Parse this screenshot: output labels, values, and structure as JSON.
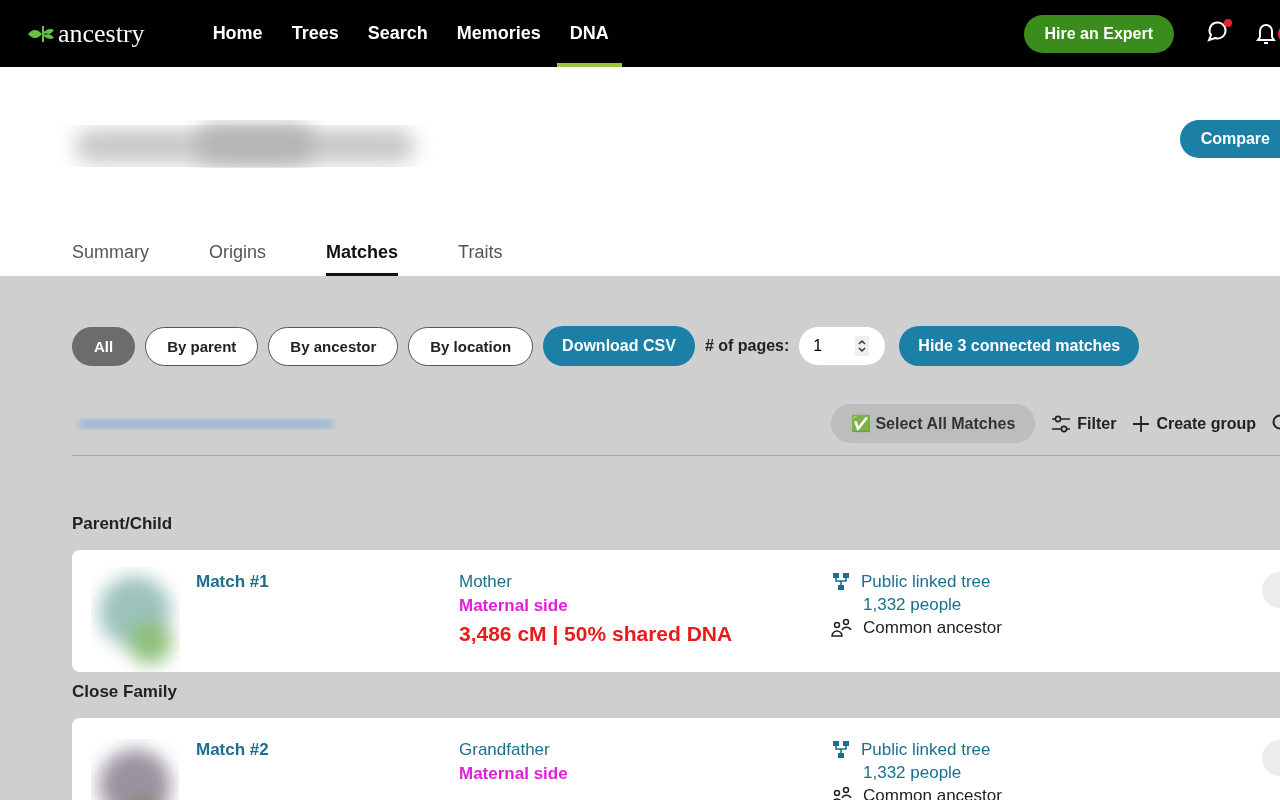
{
  "header": {
    "logo": "ancestry",
    "nav": [
      {
        "label": "Home",
        "selected": false
      },
      {
        "label": "Trees",
        "selected": false
      },
      {
        "label": "Search",
        "selected": false
      },
      {
        "label": "Memories",
        "selected": false
      },
      {
        "label": "DNA",
        "selected": true
      }
    ],
    "hire_button": "Hire an Expert",
    "messages_unread": true,
    "notifications_unread": true
  },
  "compare_button": "Compare",
  "tabs": [
    {
      "label": "Summary",
      "selected": false
    },
    {
      "label": "Origins",
      "selected": false
    },
    {
      "label": "Matches",
      "selected": true
    },
    {
      "label": "Traits",
      "selected": false
    }
  ],
  "filters": [
    {
      "label": "All",
      "selected": true
    },
    {
      "label": "By parent",
      "selected": false
    },
    {
      "label": "By ancestor",
      "selected": false
    },
    {
      "label": "By location",
      "selected": false
    }
  ],
  "download_button": "Download CSV",
  "pages": {
    "label": "# of pages:",
    "value": "1"
  },
  "hide_button": "Hide 3 connected matches",
  "toolbar": {
    "select_all": "✅ Select All Matches",
    "filter": "Filter",
    "create_group": "Create group"
  },
  "groups": [
    {
      "title": "Parent/Child",
      "matches": [
        {
          "name": "Match #1",
          "relation": "Mother",
          "side": "Maternal side",
          "shared": "3,486 cM | 50% shared DNA",
          "tree": "Public linked tree",
          "people": "1,332 people",
          "ancestor": "Common ancestor"
        }
      ]
    },
    {
      "title": "Close Family",
      "matches": [
        {
          "name": "Match #2",
          "relation": "Grandfather",
          "side": "Maternal side",
          "tree": "Public linked tree",
          "people": "1,332 people",
          "ancestor": "Common ancestor"
        }
      ]
    }
  ]
}
